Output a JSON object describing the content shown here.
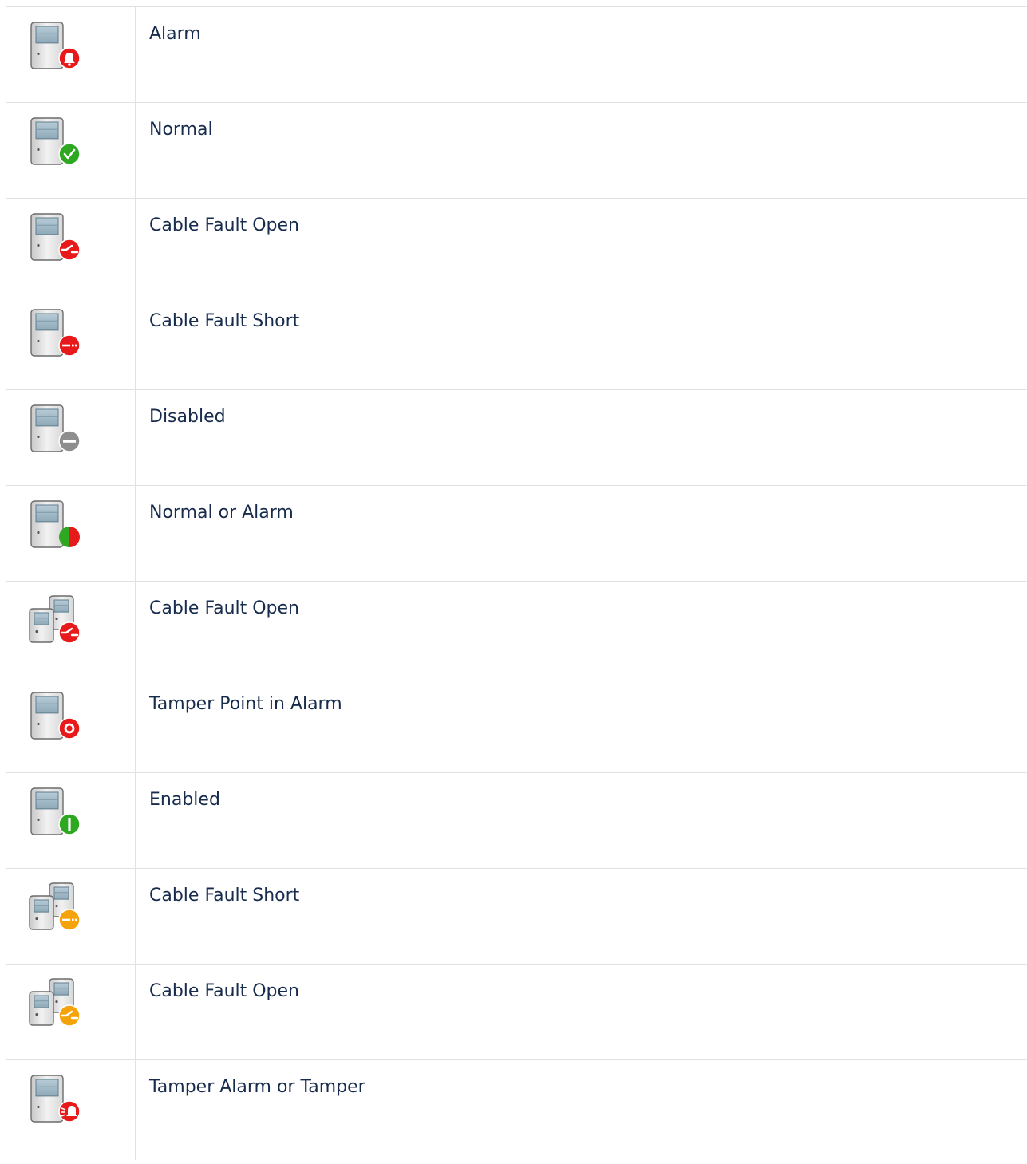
{
  "rows": [
    {
      "label": "Alarm",
      "icon": "device-alarm-icon",
      "type": "single",
      "badge": "bell",
      "color": "#e8191a"
    },
    {
      "label": "Normal",
      "icon": "device-normal-icon",
      "type": "single",
      "badge": "check",
      "color": "#2ea821"
    },
    {
      "label": "Cable Fault Open",
      "icon": "device-cable-fault-open-icon",
      "type": "single",
      "badge": "open",
      "color": "#e8191a"
    },
    {
      "label": "Cable Fault Short",
      "icon": "device-cable-fault-short-icon",
      "type": "single",
      "badge": "short",
      "color": "#e8191a"
    },
    {
      "label": "Disabled",
      "icon": "device-disabled-icon",
      "type": "single",
      "badge": "minus",
      "color": "#8e8e8e"
    },
    {
      "label": "Normal or Alarm",
      "icon": "device-normal-or-alarm-icon",
      "type": "single",
      "badge": "split",
      "color": "#e8191a",
      "color2": "#2ea821"
    },
    {
      "label": "Cable Fault Open",
      "icon": "devices-cable-fault-open-icon",
      "type": "double",
      "badge": "open",
      "color": "#e8191a"
    },
    {
      "label": "Tamper Point in Alarm",
      "icon": "device-tamper-point-alarm-icon",
      "type": "single",
      "badge": "ring",
      "color": "#e8191a"
    },
    {
      "label": "Enabled",
      "icon": "device-enabled-icon",
      "type": "single",
      "badge": "bar",
      "color": "#2ea821"
    },
    {
      "label": "Cable Fault Short",
      "icon": "devices-cable-fault-short-icon",
      "type": "double",
      "badge": "short",
      "color": "#f5a30a"
    },
    {
      "label": "Cable Fault Open",
      "icon": "devices-cable-fault-open-warning-icon",
      "type": "double",
      "badge": "open",
      "color": "#f5a30a"
    },
    {
      "label": "Tamper Alarm or Tamper",
      "icon": "device-tamper-alarm-icon",
      "type": "single",
      "badge": "bell-rays",
      "color": "#e8191a"
    }
  ]
}
